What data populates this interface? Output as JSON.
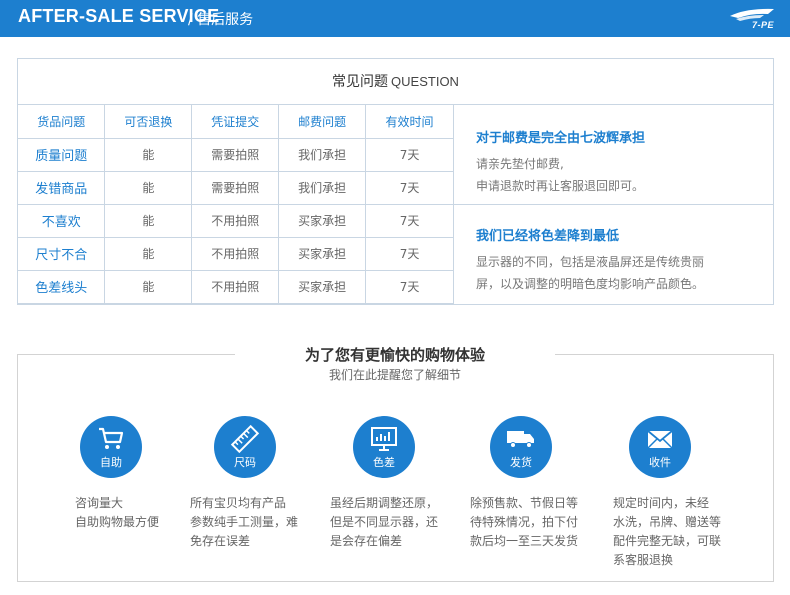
{
  "header": {
    "title": "AFTER-SALE SERVICE",
    "subtitle": "/ 售后服务",
    "logo_text": "7-PE"
  },
  "faq": {
    "title_cn": "常见问题",
    "title_en": "QUESTION",
    "columns": [
      "货品问题",
      "可否退换",
      "凭证提交",
      "邮费问题",
      "有效时间"
    ],
    "rows": [
      [
        "质量问题",
        "能",
        "需要拍照",
        "我们承担",
        "7天"
      ],
      [
        "发错商品",
        "能",
        "需要拍照",
        "我们承担",
        "7天"
      ],
      [
        "不喜欢",
        "能",
        "不用拍照",
        "买家承担",
        "7天"
      ],
      [
        "尺寸不合",
        "能",
        "不用拍照",
        "买家承担",
        "7天"
      ],
      [
        "色差线头",
        "能",
        "不用拍照",
        "买家承担",
        "7天"
      ]
    ],
    "info1": {
      "title": "对于邮费是完全由七波辉承担",
      "line1": "请亲先垫付邮费,",
      "line2": "申请退款时再让客服退回即可。"
    },
    "info2": {
      "title": "我们已经将色差降到最低",
      "line1": "显示器的不同，包括是液晶屏还是传统贵丽",
      "line2": "屏，以及调整的明暗色度均影响产品颜色。"
    }
  },
  "experience": {
    "title": "为了您有更愉快的购物体验",
    "subtitle": "我们在此提醒您了解细节",
    "items": [
      {
        "label": "自助",
        "icon": "cart-icon",
        "lines": [
          "咨询量大",
          "自助购物最方便"
        ]
      },
      {
        "label": "尺码",
        "icon": "ruler-icon",
        "lines": [
          "所有宝贝均有产品",
          "参数纯手工测量，难",
          "免存在误差"
        ]
      },
      {
        "label": "色差",
        "icon": "monitor-icon",
        "lines": [
          "虽经后期调整还原，",
          "但是不同显示器，还",
          "是会存在偏差"
        ]
      },
      {
        "label": "发货",
        "icon": "truck-icon",
        "lines": [
          "除预售款、节假日等",
          "待特殊情况，拍下付",
          "款后均一至三天发货"
        ]
      },
      {
        "label": "收件",
        "icon": "envelope-icon",
        "lines": [
          "规定时间内，未经",
          "水洗，吊牌、赠送等",
          "配件完整无缺，可联",
          "系客服退换"
        ]
      }
    ]
  },
  "colors": {
    "brand_blue": "#1d7fcf",
    "border": "#c9d6e3"
  }
}
